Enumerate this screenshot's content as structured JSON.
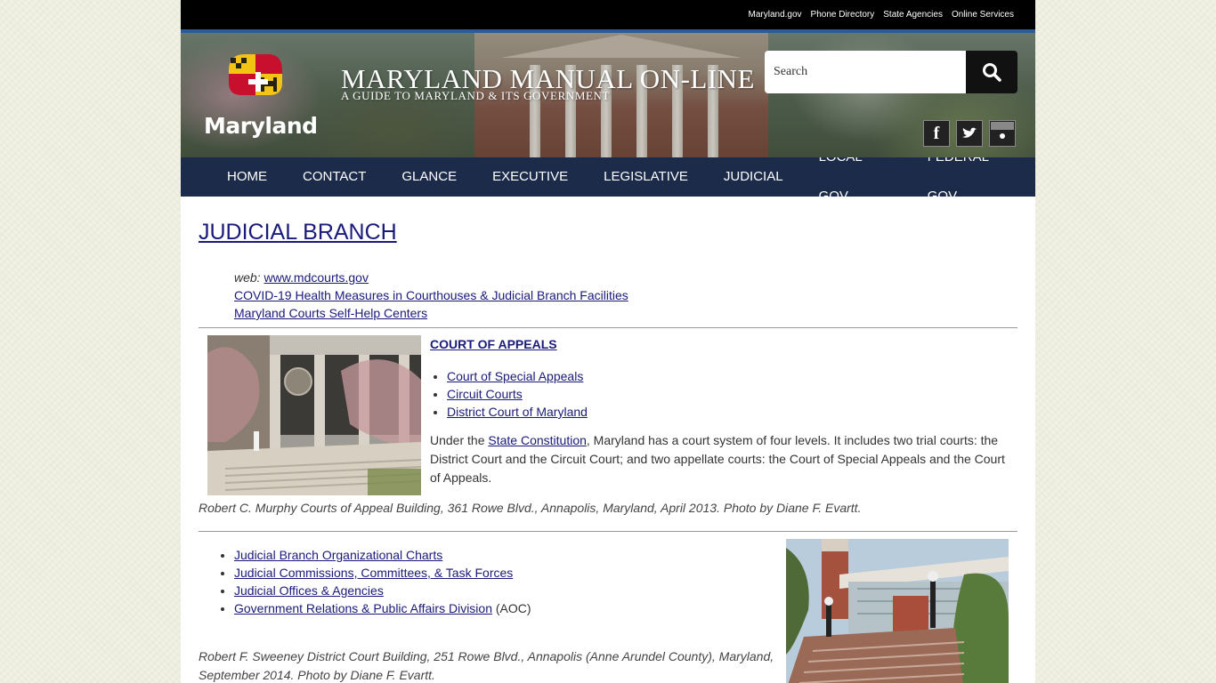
{
  "utility_links": [
    "Maryland.gov",
    "Phone Directory",
    "State Agencies",
    "Online Services"
  ],
  "header": {
    "logo_text": "Maryland",
    "title": "MARYLAND MANUAL ON-LINE",
    "subtitle": "A GUIDE TO MARYLAND & ITS GOVERNMENT",
    "search_placeholder": "Search",
    "social": [
      "facebook-icon",
      "twitter-icon",
      "flickr-icon"
    ]
  },
  "nav": [
    "HOME",
    "CONTACT",
    "GLANCE",
    "EXECUTIVE",
    "LEGISLATIVE",
    "JUDICIAL",
    "LOCAL GOV",
    "FEDERAL GOV"
  ],
  "main": {
    "title": "JUDICIAL BRANCH",
    "web_label": "web:",
    "web_link": "www.mdcourts.gov",
    "links_top": [
      "COVID-19 Health Measures in Courthouses & Judicial Branch Facilities",
      "Maryland Courts Self-Help Centers"
    ],
    "court_heading": "COURT OF APPEALS",
    "court_links": [
      "Court of Special Appeals",
      "Circuit Courts",
      "District Court of Maryland"
    ],
    "para_pre": "Under the ",
    "para_link": "State Constitution",
    "para_post": ", Maryland has a court system of four levels. It includes two trial courts: the District Court and the Circuit Court; and two appellate courts: the Court of Special Appeals and the Court of Appeals.",
    "caption1": "Robert C. Murphy Courts of Appeal Building, 361 Rowe Blvd., Annapolis, Maryland, April 2013. Photo by Diane F. Evartt.",
    "links_bottom": [
      "Judicial Branch Organizational Charts",
      "Judicial Commissions, Committees, & Task Forces",
      "Judicial Offices & Agencies",
      "Government Relations & Public Affairs Division"
    ],
    "aoc_suffix": " (AOC)",
    "caption2": "Robert F. Sweeney District Court Building, 251 Rowe Blvd., Annapolis (Anne Arundel County), Maryland, September 2014. Photo by Diane F. Evartt."
  },
  "colors": {
    "nav_bg": "#1c2b4a",
    "link": "#1a1a7a",
    "accent_line": "#2a5b9e"
  }
}
